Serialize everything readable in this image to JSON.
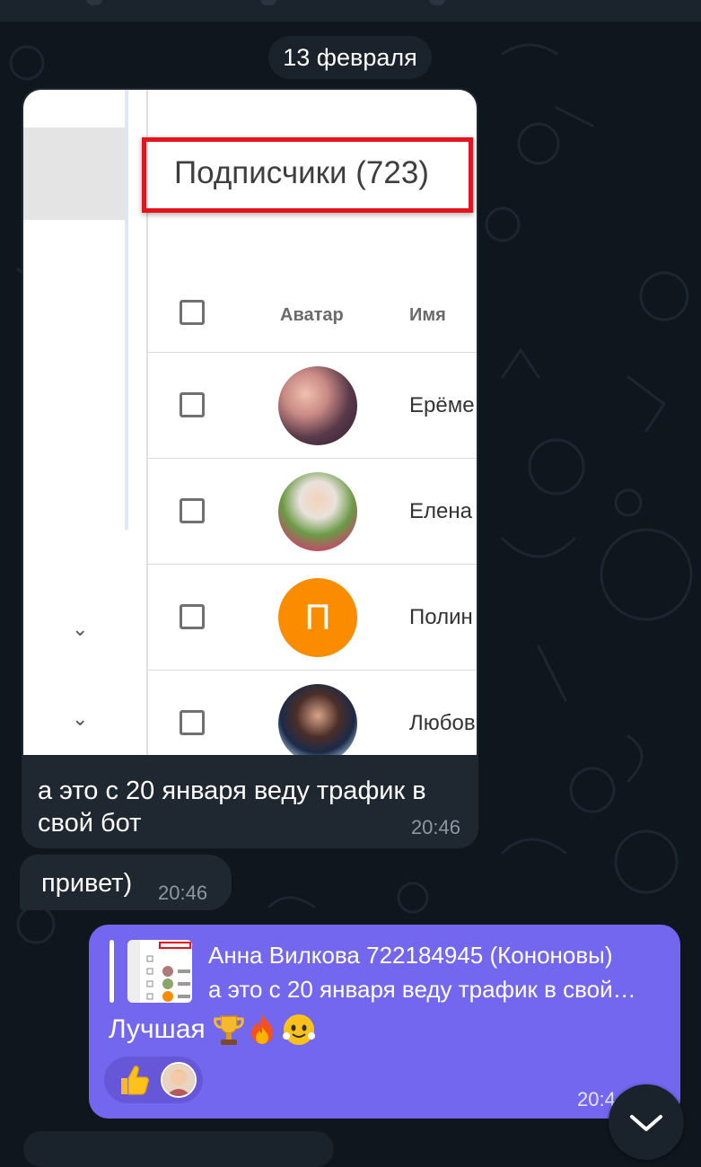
{
  "chat": {
    "date_separator": "13 февраля",
    "messages": [
      {
        "image": {
          "title": "Подписчики (723)",
          "headers": {
            "avatar": "Аватар",
            "name": "Имя"
          },
          "rows": [
            {
              "name": "Ерёме",
              "avatar_letter": ""
            },
            {
              "name": "Елена",
              "avatar_letter": ""
            },
            {
              "name": "Полин",
              "avatar_letter": "П"
            },
            {
              "name": "Любов",
              "avatar_letter": ""
            }
          ]
        },
        "text_line1": "а это с 20 января веду трафик в",
        "text_line2": "свой бот",
        "time": "20:46"
      },
      {
        "text": "привет)",
        "time": "20:46"
      },
      {
        "reply": {
          "author": "Анна Вилкова 722184945 (Кононовы)",
          "text": "а это с 20 января веду трафик в свой…"
        },
        "text": "Лучшая",
        "emojis": [
          "trophy-emoji",
          "fire-emoji",
          "smiling-face-emoji"
        ],
        "reaction": {
          "emoji": "thumbs-up-emoji"
        },
        "time": "20:4"
      }
    ]
  },
  "colors": {
    "background": "#0f161e",
    "incoming_bubble": "#1f2730",
    "outgoing_bubble": "#7367f0",
    "highlight_box": "#e3141b"
  }
}
